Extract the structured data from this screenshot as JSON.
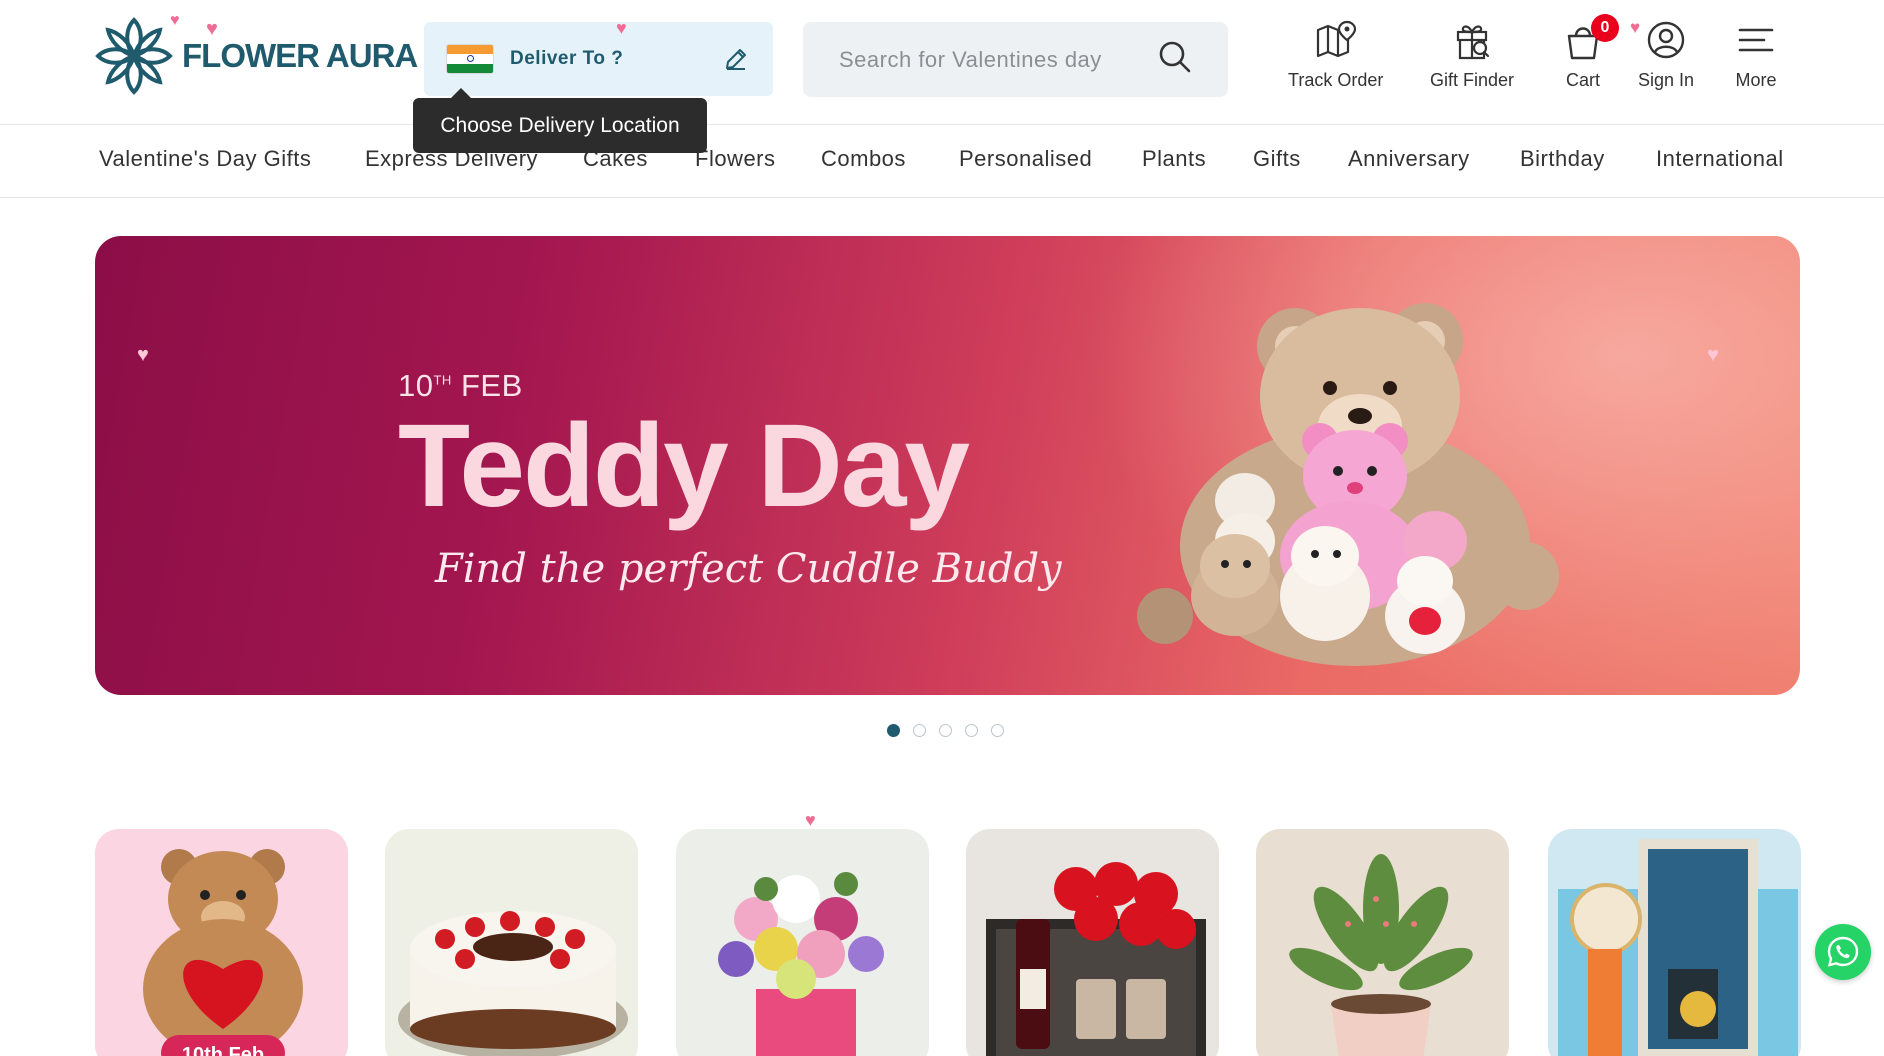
{
  "header": {
    "logo_text": "FLOWER AURA",
    "deliver_label": "Deliver To ?",
    "tooltip": "Choose Delivery Location",
    "search_placeholder": "Search for Valentines day",
    "actions": [
      {
        "label": "Track Order",
        "icon": "map-pin-icon"
      },
      {
        "label": "Gift Finder",
        "icon": "gift-search-icon"
      },
      {
        "label": "Cart",
        "icon": "cart-icon",
        "badge": "0"
      },
      {
        "label": "Sign In",
        "icon": "user-icon"
      },
      {
        "label": "More",
        "icon": "menu-icon"
      }
    ]
  },
  "nav": {
    "items": [
      "Valentine's Day Gifts",
      "Express Delivery",
      "Cakes",
      "Flowers",
      "Combos",
      "Personalised",
      "Plants",
      "Gifts",
      "Anniversary",
      "Birthday",
      "International"
    ]
  },
  "banner": {
    "date_prefix": "10",
    "date_sup": "TH",
    "date_month": "FEB",
    "title": "Teddy Day",
    "subtitle": "Find the perfect Cuddle Buddy"
  },
  "carousel": {
    "total": 5,
    "active": 1
  },
  "cards": [
    {
      "name": "teddy-card",
      "badge": "10th Feb"
    },
    {
      "name": "cake-card"
    },
    {
      "name": "flowers-card"
    },
    {
      "name": "combo-card"
    },
    {
      "name": "plant-card"
    },
    {
      "name": "gift-box-card"
    }
  ],
  "colors": {
    "brand": "#1f5b6d",
    "accent_pink": "#f06c95",
    "cart_badge": "#e8001c",
    "whatsapp": "#25d366"
  }
}
